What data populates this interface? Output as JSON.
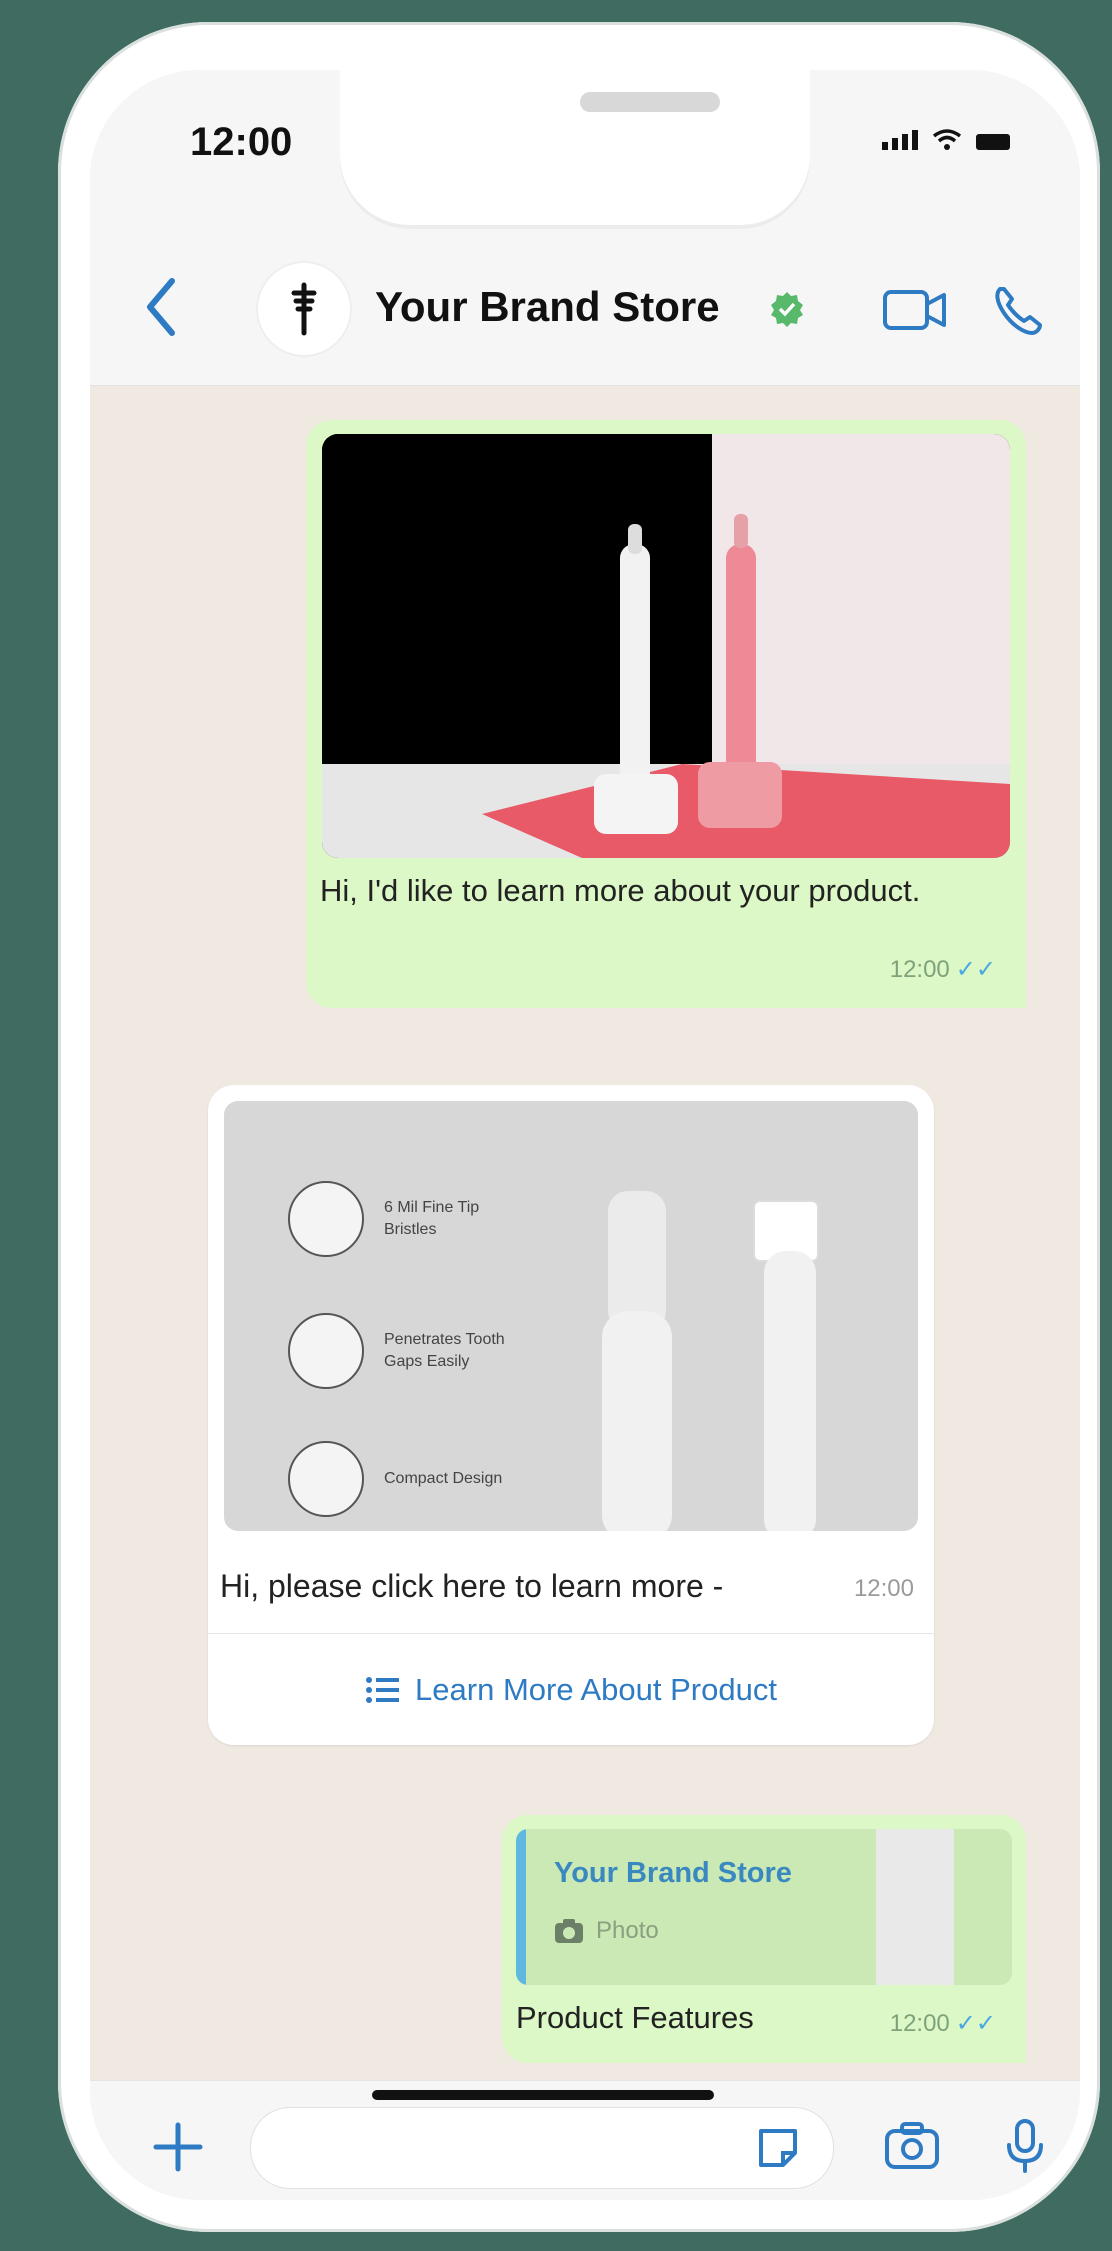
{
  "status": {
    "time": "12:00"
  },
  "header": {
    "title": "Your Brand Store",
    "back_label": "<"
  },
  "messages": {
    "out1": {
      "text": "Hi, I'd like to learn more about your product.",
      "time": "12:00"
    },
    "in1": {
      "features": [
        "6 Mil Fine Tip Bristles",
        "Penetrates Tooth Gaps Easily",
        "Compact Design"
      ],
      "text": "Hi, please click here to learn more -",
      "time": "12:00",
      "button_label": "Learn More About Product"
    },
    "out2": {
      "quote_name": "Your Brand Store",
      "quote_type": "Photo",
      "text": "Product Features",
      "time": "12:00"
    }
  },
  "colors": {
    "bg": "#3f6b61",
    "out_bubble": "#dcf8c6",
    "accent_blue": "#2e7bc4",
    "verified_green": "#58b96a"
  },
  "icons": [
    "back-chevron-icon",
    "verified-badge-icon",
    "video-call-icon",
    "voice-call-icon",
    "plus-icon",
    "sticker-icon",
    "camera-icon",
    "microphone-icon",
    "list-icon",
    "read-ticks-icon"
  ]
}
